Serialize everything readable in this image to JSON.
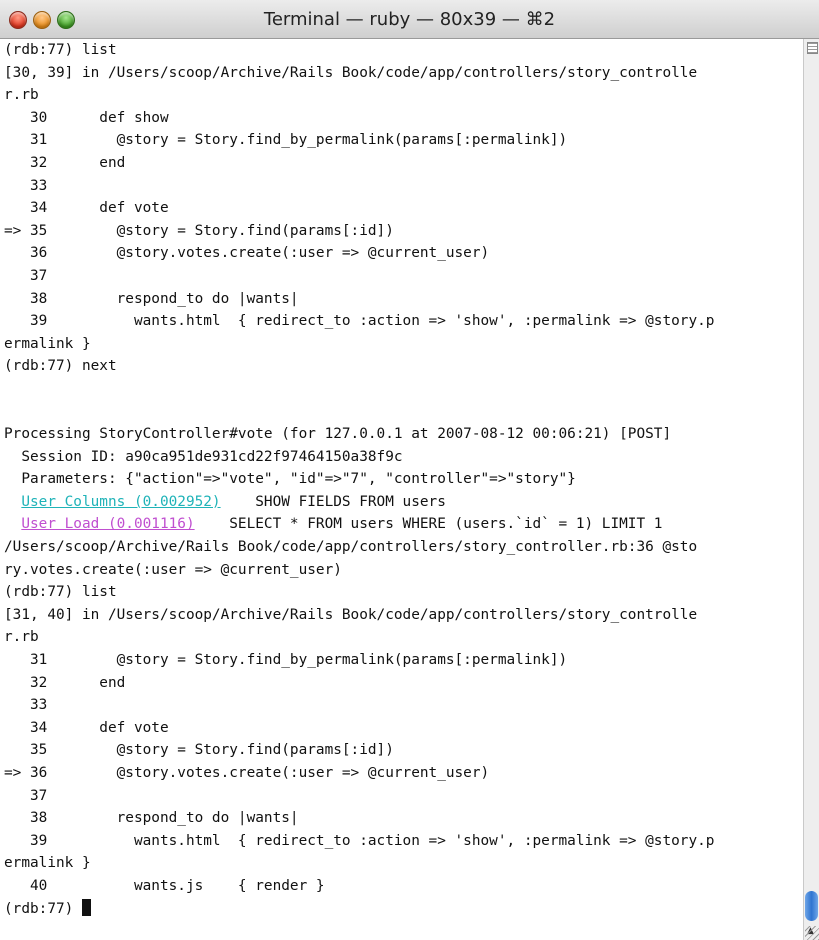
{
  "window": {
    "title": "Terminal — ruby — 80x39 — ⌘2"
  },
  "colors": {
    "link_cyan": "#1fb3b8",
    "link_magenta": "#c04fd0",
    "scroll_thumb": "#2f74d0"
  },
  "icons": {
    "close": "close-icon",
    "minimize": "minimize-icon",
    "zoom": "zoom-icon",
    "split": "split-pane-icon",
    "up": "chevron-up-icon",
    "down": "chevron-down-icon",
    "resize": "resize-grip-icon"
  },
  "terminal": {
    "lines": [
      {
        "text": "(rdb:77) list"
      },
      {
        "text": "[30, 39] in /Users/scoop/Archive/Rails Book/code/app/controllers/story_controlle"
      },
      {
        "text": "r.rb"
      },
      {
        "text": "   30      def show"
      },
      {
        "text": "   31        @story = Story.find_by_permalink(params[:permalink])"
      },
      {
        "text": "   32      end"
      },
      {
        "text": "   33"
      },
      {
        "text": "   34      def vote"
      },
      {
        "text": "=> 35        @story = Story.find(params[:id])"
      },
      {
        "text": "   36        @story.votes.create(:user => @current_user)"
      },
      {
        "text": "   37"
      },
      {
        "text": "   38        respond_to do |wants|"
      },
      {
        "text": "   39          wants.html  { redirect_to :action => 'show', :permalink => @story.p"
      },
      {
        "text": "ermalink }"
      },
      {
        "text": "(rdb:77) next"
      },
      {
        "text": ""
      },
      {
        "text": ""
      },
      {
        "text": "Processing StoryController#vote (for 127.0.0.1 at 2007-08-12 00:06:21) [POST]"
      },
      {
        "text": "  Session ID: a90ca951de931cd22f97464150a38f9c"
      },
      {
        "text": "  Parameters: {\"action\"=>\"vote\", \"id\"=>\"7\", \"controller\"=>\"story\"}"
      },
      {
        "text": "  ",
        "link": "User Columns (0.002952)",
        "link_style": "cyan",
        "rest": "    SHOW FIELDS FROM users"
      },
      {
        "text": "  ",
        "link": "User Load (0.001116)",
        "link_style": "magenta",
        "rest": "    SELECT * FROM users WHERE (users.`id` = 1) LIMIT 1"
      },
      {
        "text": "/Users/scoop/Archive/Rails Book/code/app/controllers/story_controller.rb:36 @sto"
      },
      {
        "text": "ry.votes.create(:user => @current_user)"
      },
      {
        "text": "(rdb:77) list"
      },
      {
        "text": "[31, 40] in /Users/scoop/Archive/Rails Book/code/app/controllers/story_controlle"
      },
      {
        "text": "r.rb"
      },
      {
        "text": "   31        @story = Story.find_by_permalink(params[:permalink])"
      },
      {
        "text": "   32      end"
      },
      {
        "text": "   33"
      },
      {
        "text": "   34      def vote"
      },
      {
        "text": "   35        @story = Story.find(params[:id])"
      },
      {
        "text": "=> 36        @story.votes.create(:user => @current_user)"
      },
      {
        "text": "   37"
      },
      {
        "text": "   38        respond_to do |wants|"
      },
      {
        "text": "   39          wants.html  { redirect_to :action => 'show', :permalink => @story.p"
      },
      {
        "text": "ermalink }"
      },
      {
        "text": "   40          wants.js    { render }"
      },
      {
        "text": "(rdb:77) ",
        "cursor": true
      }
    ]
  }
}
